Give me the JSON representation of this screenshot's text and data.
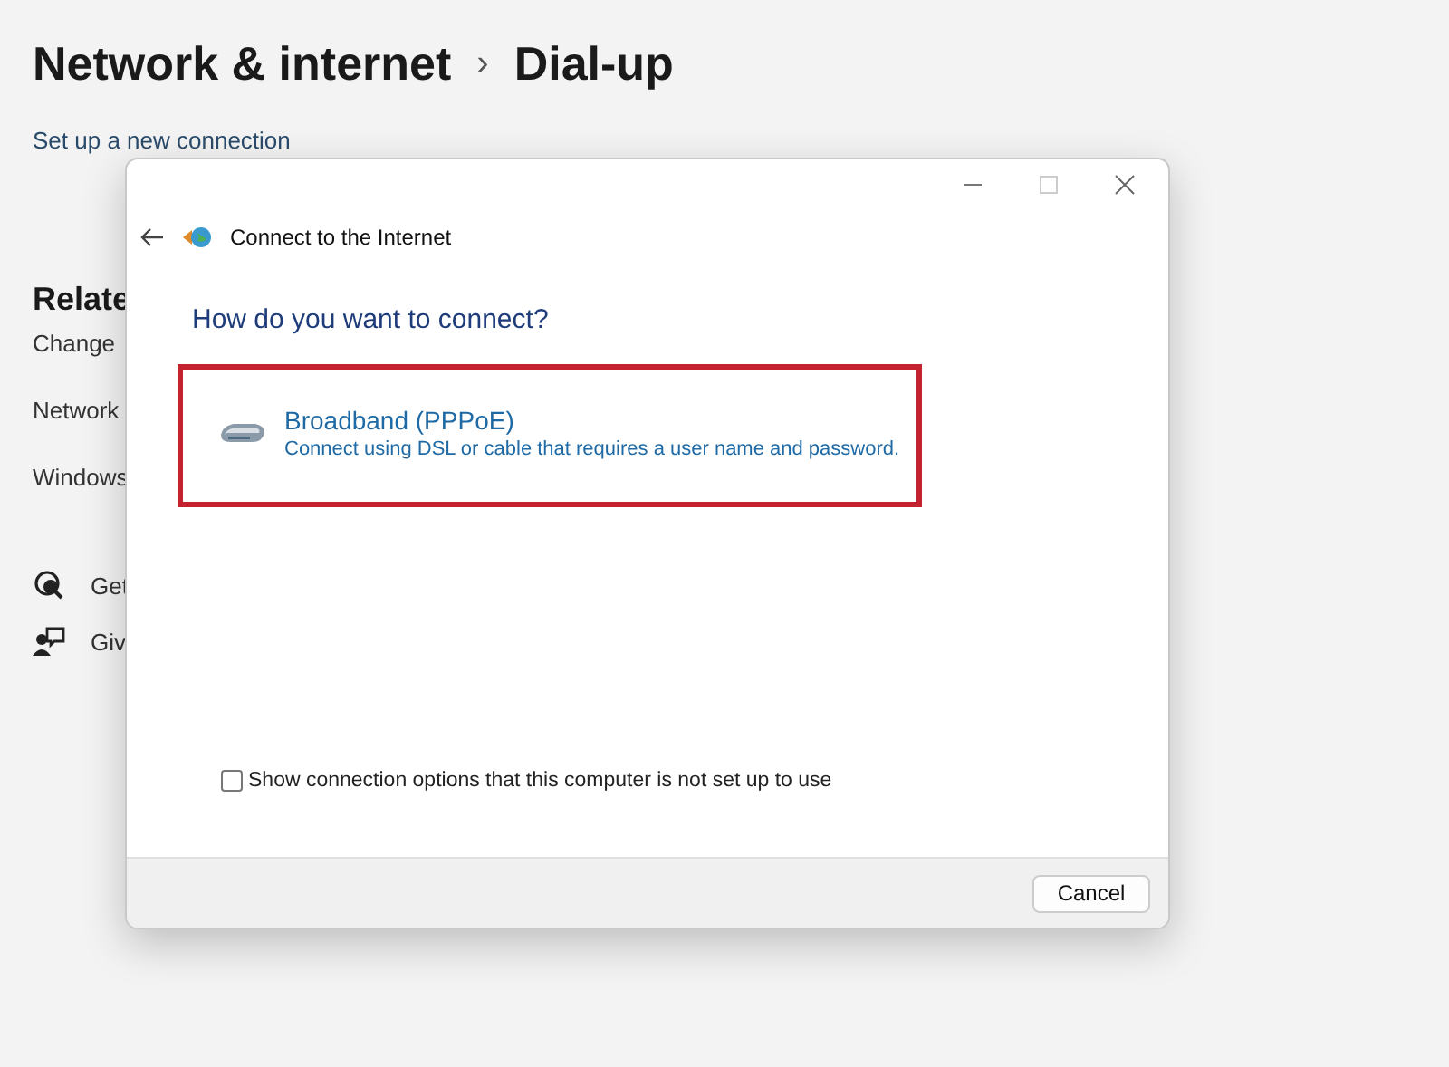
{
  "settings": {
    "breadcrumb": [
      {
        "label": "Network & internet"
      },
      {
        "label": "Dial-up"
      }
    ],
    "separator": "›",
    "link": "Set up a new connection",
    "related_heading": "Relate",
    "related_items": [
      {
        "label": "Change"
      },
      {
        "label": "Network"
      },
      {
        "label": "Windows"
      }
    ],
    "help_items": [
      {
        "kind": "help",
        "label": "Get"
      },
      {
        "kind": "feedback",
        "label": "Giv"
      }
    ]
  },
  "dialog": {
    "title": "Connect to the Internet",
    "heading": "How do you want to connect?",
    "options": [
      {
        "title": "Broadband (PPPoE)",
        "description": "Connect using DSL or cable that requires a user name and password.",
        "highlighted": true
      }
    ],
    "show_all": {
      "label": "Show connection options that this computer is not set up to use",
      "checked": false
    },
    "buttons": [
      "Cancel"
    ]
  }
}
